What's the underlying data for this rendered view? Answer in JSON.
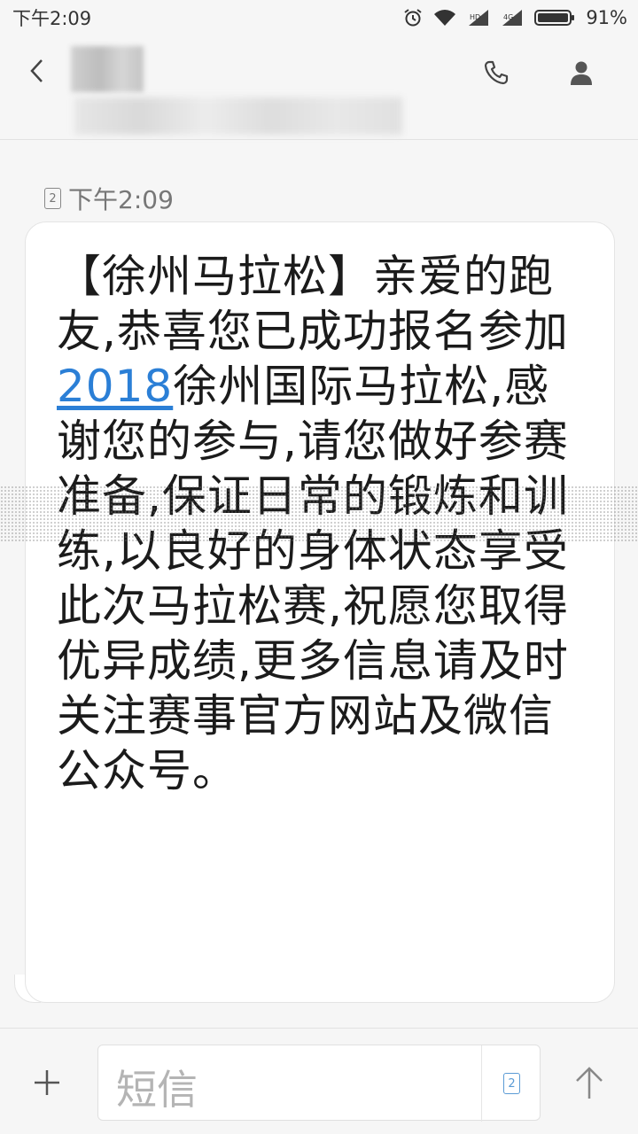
{
  "status_bar": {
    "time": "下午2:09",
    "battery_percent": "91%",
    "battery_level": 0.91,
    "icons": [
      "alarm-icon",
      "wifi-icon",
      "signal-icon",
      "signal-icon",
      "battery-icon"
    ]
  },
  "header": {
    "back_icon": "chevron-left-icon",
    "call_icon": "phone-icon",
    "contact_icon": "person-icon"
  },
  "conversation": {
    "sim_slot": "2",
    "timestamp": "下午2:09",
    "message": {
      "before_link": "【徐州马拉松】亲爱的跑友,恭喜您已成功报名参加",
      "link_text": "2018",
      "after_link": "徐州国际马拉松,感谢您的参与,请您做好参赛准备,保证日常的锻炼和训练,以良好的身体状态享受此次马拉松赛,祝愿您取得优异成绩,更多信息请及时关注赛事官方网站及微信公众号。"
    }
  },
  "composer": {
    "attach_icon": "plus-icon",
    "placeholder": "短信",
    "sim_slot": "2",
    "send_icon": "arrow-up-icon"
  },
  "colors": {
    "link": "#2b7fd6",
    "sim_badge": "#5b9bd5"
  }
}
